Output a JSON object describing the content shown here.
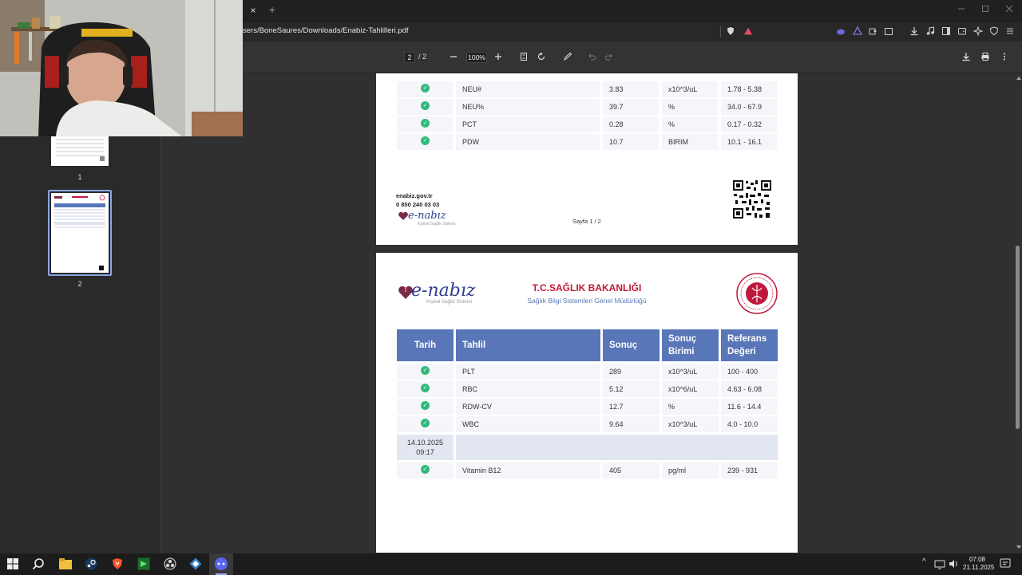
{
  "browser": {
    "url": "sers/BoneSaures/Downloads/Enabiz-Tahlilleri.pdf",
    "tab_close": "×",
    "tab_new": "+"
  },
  "pdf_toolbar": {
    "page_current": "2",
    "page_total": "/ 2",
    "zoom": "100%"
  },
  "thumbnails": [
    {
      "label": "1"
    },
    {
      "label": "2"
    }
  ],
  "page1": {
    "rows": [
      {
        "test": "NEU#",
        "result": "3.83",
        "unit": "x10^3/uL",
        "ref": "1.78 - 5.38"
      },
      {
        "test": "NEU%",
        "result": "39.7",
        "unit": "%",
        "ref": "34.0 - 67.9"
      },
      {
        "test": "PCT",
        "result": "0.28",
        "unit": "%",
        "ref": "0.17 - 0.32"
      },
      {
        "test": "PDW",
        "result": "10.7",
        "unit": "BIRIM",
        "ref": "10.1 - 16.1"
      }
    ],
    "footer_site": "enabiz.gov.tr",
    "footer_phone": "0 850 240 03 03",
    "logo_text": "e-nabız",
    "logo_sub": "Kişisel Sağlık Sistemi",
    "page_indicator": "Sayfa 1 / 2"
  },
  "page2": {
    "logo_text": "e-nabız",
    "logo_sub": "Kişisel Sağlık Sistemi",
    "ministry_title": "T.C.SAĞLIK BAKANLIĞI",
    "ministry_sub": "Sağlık Bilgi Sistemleri Genel Müdürlüğü",
    "headers": {
      "date": "Tarih",
      "test": "Tahlil",
      "result": "Sonuç",
      "unit_1": "Sonuç",
      "unit_2": "Birimi",
      "ref_1": "Referans",
      "ref_2": "Değeri"
    },
    "rows": [
      {
        "test": "PLT",
        "result": "289",
        "unit": "x10^3/uL",
        "ref": "100 - 400"
      },
      {
        "test": "RBC",
        "result": "5.12",
        "unit": "x10^6/uL",
        "ref": "4.63 - 6.08"
      },
      {
        "test": "RDW-CV",
        "result": "12.7",
        "unit": "%",
        "ref": "11.6 - 14.4"
      },
      {
        "test": "WBC",
        "result": "9.64",
        "unit": "x10^3/uL",
        "ref": "4.0 - 10.0"
      }
    ],
    "date_row": {
      "date": "14.10.2025",
      "time": "09:17"
    },
    "last_row": {
      "test": "Vitamin B12",
      "result": "405",
      "unit": "pg/ml",
      "ref": "239 - 931"
    }
  },
  "taskbar": {
    "time": "07:08",
    "date": "21.11.2025",
    "tray_chevron": "^"
  },
  "colors": {
    "header_blue": "#5876b8",
    "check_green": "#32b97e",
    "ministry_red": "#c0183c",
    "brand_navy": "#2f3d8f"
  }
}
